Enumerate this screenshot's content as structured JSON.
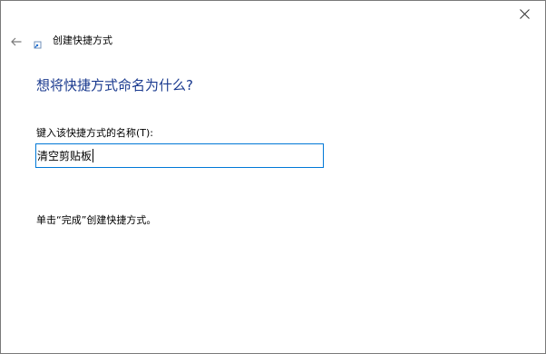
{
  "window": {
    "wizard_title": "创建快捷方式",
    "close_icon": "close-icon",
    "back_icon": "back-arrow-icon"
  },
  "page": {
    "heading": "想将快捷方式命名为什么?",
    "field_label": "键入该快捷方式的名称(T):",
    "name_value": "清空剪贴板",
    "hint": "单击“完成”创建快捷方式。"
  },
  "colors": {
    "heading": "#1a3a8f",
    "input_border_focus": "#0078d7",
    "window_border": "#7a7a7a"
  }
}
